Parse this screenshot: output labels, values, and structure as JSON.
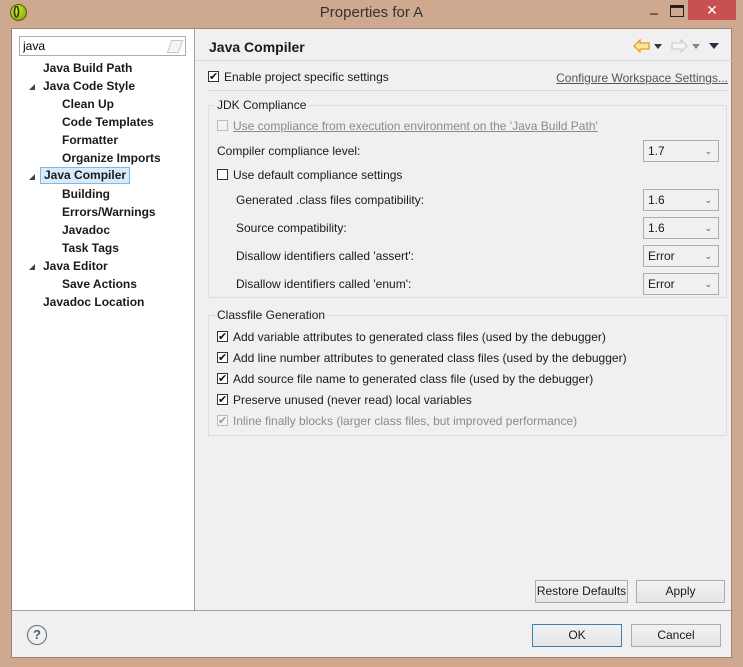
{
  "window": {
    "title": "Properties for A",
    "minimize_icon": "minimize-icon",
    "maximize_icon": "maximize-icon",
    "close_glyph": "✕"
  },
  "sidebar": {
    "filter_value": "java",
    "filter_clear_icon": "clear-filter-icon",
    "items": [
      {
        "label": "Java Build Path",
        "level": 0,
        "expandable": false
      },
      {
        "label": "Java Code Style",
        "level": 0,
        "expandable": true
      },
      {
        "label": "Clean Up",
        "level": 1
      },
      {
        "label": "Code Templates",
        "level": 1
      },
      {
        "label": "Formatter",
        "level": 1
      },
      {
        "label": "Organize Imports",
        "level": 1
      },
      {
        "label": "Java Compiler",
        "level": 0,
        "expandable": true,
        "selected": true
      },
      {
        "label": "Building",
        "level": 1
      },
      {
        "label": "Errors/Warnings",
        "level": 1
      },
      {
        "label": "Javadoc",
        "level": 1
      },
      {
        "label": "Task Tags",
        "level": 1
      },
      {
        "label": "Java Editor",
        "level": 0,
        "expandable": true
      },
      {
        "label": "Save Actions",
        "level": 1
      },
      {
        "label": "Javadoc Location",
        "level": 0,
        "expandable": false
      }
    ]
  },
  "page": {
    "title": "Java Compiler",
    "enable_project_specific": {
      "label": "Enable project specific settings",
      "checked": true
    },
    "configure_link": "Configure Workspace Settings...",
    "jdk_compliance": {
      "title": "JDK Compliance",
      "use_ee_compliance": {
        "label_prefix": "Use compliance from execution environment on the ",
        "link": "'Java Build Path'",
        "checked": false,
        "disabled": true
      },
      "compliance_level": {
        "label": "Compiler compliance level:",
        "value": "1.7"
      },
      "use_default": {
        "label": "Use default compliance settings",
        "checked": false
      },
      "generated_class": {
        "label": "Generated .class files compatibility:",
        "value": "1.6"
      },
      "source_compat": {
        "label": "Source compatibility:",
        "value": "1.6"
      },
      "assert_ident": {
        "label": "Disallow identifiers called 'assert':",
        "value": "Error"
      },
      "enum_ident": {
        "label": "Disallow identifiers called 'enum':",
        "value": "Error"
      }
    },
    "classfile": {
      "title": "Classfile Generation",
      "options": [
        {
          "label": "Add variable attributes to generated class files (used by the debugger)",
          "checked": true,
          "disabled": false
        },
        {
          "label": "Add line number attributes to generated class files (used by the debugger)",
          "checked": true,
          "disabled": false
        },
        {
          "label": "Add source file name to generated class file (used by the debugger)",
          "checked": true,
          "disabled": false
        },
        {
          "label": "Preserve unused (never read) local variables",
          "checked": true,
          "disabled": false
        },
        {
          "label": "Inline finally blocks (larger class files, but improved performance)",
          "checked": true,
          "disabled": true
        }
      ]
    },
    "restore_defaults": "Restore Defaults",
    "apply": "Apply"
  },
  "footer": {
    "help_glyph": "?",
    "ok": "OK",
    "cancel": "Cancel"
  },
  "colors": {
    "window_frame": "#cfa98f",
    "close_button": "#c75050",
    "selection": "#d9ebf9",
    "back_arrow": "#f0b020"
  }
}
